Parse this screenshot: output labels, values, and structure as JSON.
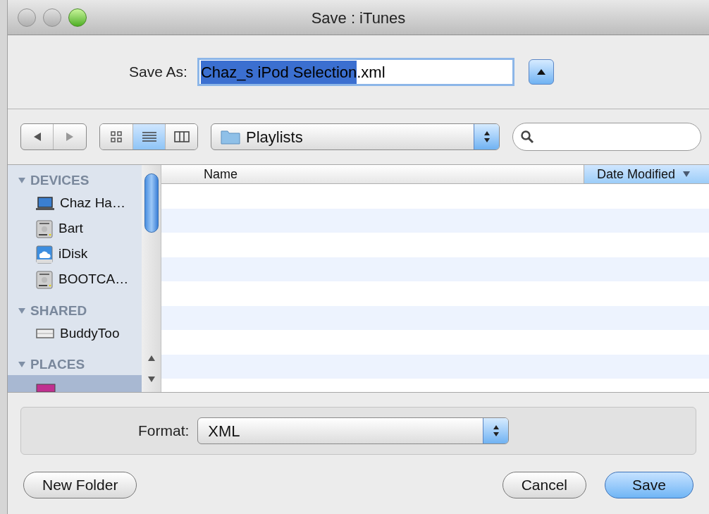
{
  "window": {
    "title": "Save : iTunes"
  },
  "save_as": {
    "label": "Save As:",
    "selected_text": "Chaz_s iPod Selection",
    "rest_text": ".xml",
    "expanded": false
  },
  "toolbar": {
    "view_buttons": [
      {
        "kind": "icons",
        "selected": false
      },
      {
        "kind": "list",
        "selected": true
      },
      {
        "kind": "columns",
        "selected": false
      }
    ],
    "location": "Playlists"
  },
  "sidebar": {
    "sections": [
      {
        "title": "DEVICES",
        "items": [
          {
            "label": "Chaz Ha…",
            "kind": "laptop",
            "selected": false
          },
          {
            "label": "Bart",
            "kind": "drive",
            "selected": false
          },
          {
            "label": "iDisk",
            "kind": "idisk",
            "selected": false
          },
          {
            "label": "BOOTCA…",
            "kind": "drive",
            "selected": false
          }
        ]
      },
      {
        "title": "SHARED",
        "items": [
          {
            "label": "BuddyToo",
            "kind": "network",
            "selected": false
          }
        ]
      },
      {
        "title": "PLACES",
        "items": [
          {
            "kind": "desktop",
            "selected": true
          }
        ]
      }
    ]
  },
  "file_list": {
    "columns": [
      {
        "label": "Name",
        "selected": false
      },
      {
        "label": "Date Modified",
        "selected": true
      }
    ]
  },
  "format": {
    "label": "Format:",
    "value": "XML"
  },
  "buttons": [
    {
      "label": "New Folder",
      "kind": "normal"
    },
    {
      "label": "Cancel",
      "kind": "normal"
    },
    {
      "label": "Save",
      "kind": "default"
    }
  ]
}
